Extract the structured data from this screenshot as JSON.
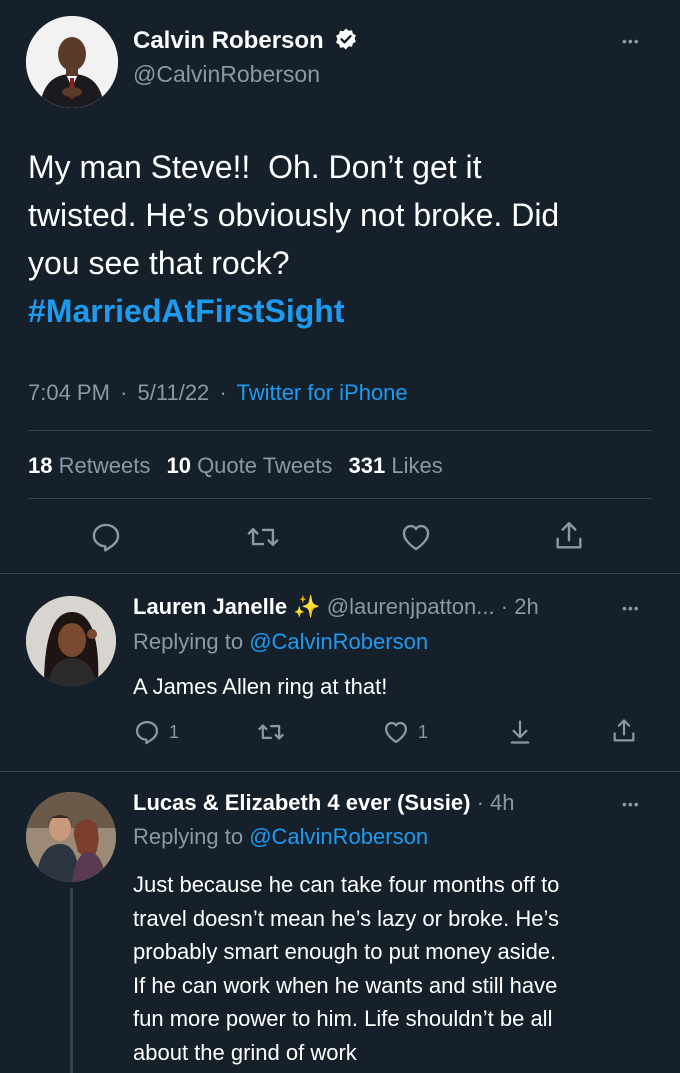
{
  "main_tweet": {
    "author_name": "Calvin Roberson",
    "author_handle": "@CalvinRoberson",
    "text_line1": "My man Steve!!  Oh. Don’t get it",
    "text_line2": "twisted. He’s obviously not broke. Did",
    "text_line3": "you see that rock?",
    "hashtag": "#MarriedAtFirstSight",
    "time": "7:04 PM",
    "date": "5/11/22",
    "source": "Twitter for iPhone",
    "retweets_count": "18",
    "retweets_label": "Retweets",
    "quotes_count": "10",
    "quotes_label": "Quote Tweets",
    "likes_count": "331",
    "likes_label": "Likes"
  },
  "replies": [
    {
      "author_name": "Lauren Janelle",
      "emoji": "✨",
      "author_handle": "@laurenjpatton...",
      "age": "2h",
      "replying_prefix": "Replying to",
      "replying_to": "@CalvinRoberson",
      "text": "A James Allen ring at that!",
      "reply_count": "1",
      "like_count": "1"
    },
    {
      "author_name": "Lucas & Elizabeth 4 ever (Susie)",
      "age": "4h",
      "replying_prefix": "Replying to",
      "replying_to": "@CalvinRoberson",
      "text_lines": [
        "Just because he can take four months off to",
        "travel doesn’t mean he’s lazy or broke. He’s",
        "probably smart enough to put money aside.",
        "If he can work when he wants and still have",
        "fun more power to him. Life shouldn’t be all",
        "about the grind of work"
      ]
    }
  ],
  "separators": {
    "dot": "·",
    "more": "•••"
  },
  "colors": {
    "background": "#15202b",
    "link": "#1d9bf0",
    "muted": "#8b98a5",
    "divider": "#38444d"
  }
}
